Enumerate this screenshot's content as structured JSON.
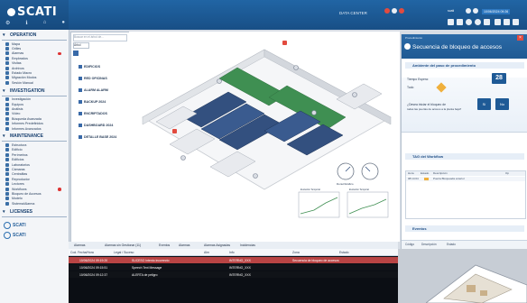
{
  "app": {
    "logo_text": "SCATI",
    "view_title": "DATA CENTER"
  },
  "topbar": {
    "user": "scati",
    "datetime": "10/06/2024 09:26"
  },
  "sidebar": {
    "sections": [
      {
        "title": "OPERATION",
        "items": [
          "Mapa",
          "Grilles",
          "Alarmas",
          "Empleados",
          "Visitas",
          "Archivos",
          "Estado Macro",
          "Migración Modos",
          "Sesión Manual"
        ]
      },
      {
        "title": "INVESTIGATION",
        "items": [
          "Investigación",
          "Equipos",
          "Análisis",
          "Vídeo",
          "Búsqueda Avanzada",
          "Informes Predefinidos",
          "Informes Avanzados"
        ]
      },
      {
        "title": "MAINTENANCE",
        "items": [
          "Estructura",
          "Edificio",
          "Perímetros",
          "Edificios",
          "Laboratorios",
          "Cámaras",
          "Centralitas",
          "Reproductor",
          "Lectores",
          "Workflows",
          "Bloqueo de Accesos",
          "Modelo",
          "Sistema/Alarma"
        ]
      },
      {
        "title": "LICENSES",
        "items": []
      }
    ],
    "licenses": [
      "SCATI",
      "SCATI"
    ]
  },
  "tree": {
    "search_placeholder": "Buscar en el árbol de...",
    "tab": "Árbol",
    "nodes": [
      "EDIFICIOS",
      "RED OFICINAS",
      "ALARM ALARM",
      "BACKUP 2024",
      "ENCRIPTADOS",
      "DASHBOARD 2024",
      "DETALLE BASE 2024"
    ]
  },
  "map": {
    "gauge_label": "Donut/Gráfico",
    "chart1_label": "Evolución Temporal",
    "chart2_label": "Evolución Temporal"
  },
  "right_panel": {
    "header_small": "Procedimiento",
    "title": "Secuencia de bloqueo de accesos",
    "section_step": "Ambiente del paso de procedimiento",
    "step_number": "28",
    "prompt_label": "Tiempo Espera:",
    "state_label": "Todo",
    "question": "¿Desea iniciar el bloqueo de todas las puertas de acceso?",
    "question2": "¿Desea iniciar el bloqueo de",
    "question3": "todas las puertas de acceso a la planta baja?",
    "yes_label": "Sí",
    "no_label": "No",
    "section_workflow": "TAG del Workflow",
    "wf_cols": [
      "Hora",
      "Estado",
      "Descripción",
      "Op"
    ],
    "wf_row": [
      "08:14:04",
      "",
      "Puerta Bloqueada exterior",
      ""
    ],
    "events_title": "Eventos",
    "events_cols": [
      "Código",
      "Descripción",
      "Estado"
    ]
  },
  "alarms": {
    "tabs": [
      "Alarmas",
      "Alarmas sin Gestionar (11)",
      "Eventos",
      "Alarmas",
      "Alarmas Asignadas",
      "Incidencias"
    ],
    "cols": [
      "Cod. Fecha/Hora",
      "Legal / Suceso",
      "Alm",
      "Info",
      "Zona",
      "Estado"
    ],
    "rows": [
      {
        "time": "10/06/2024 09:19:20",
        "desc": "SUCESO Intento incorrecto",
        "info": "INTERNO_XXX",
        "extra": "Secuencia de bloqueo de accesos",
        "color": "#b94444"
      },
      {
        "time": "10/06/2024 09:15:51",
        "desc": "Speech Text Message",
        "info": "INTERNO_XXX",
        "extra": "",
        "color": "#101318"
      },
      {
        "time": "10/06/2024 09:12:37",
        "desc": "ALERTA de peligro",
        "info": "INTERNO_XXX",
        "extra": "",
        "color": "#101318"
      }
    ]
  },
  "colors": {
    "brand": "#1e5a94",
    "accent": "#2c77c0",
    "alarm": "#b94444"
  }
}
